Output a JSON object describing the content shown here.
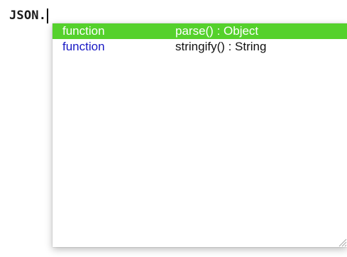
{
  "editor": {
    "code_text": "JSON."
  },
  "autocomplete": {
    "items": [
      {
        "kind": "function",
        "signature": "parse() : Object",
        "selected": true
      },
      {
        "kind": "function",
        "signature": "stringify() : String",
        "selected": false
      }
    ],
    "colors": {
      "selected_background": "#55d12c",
      "kind_text": "#1919c4",
      "selected_text": "#ffffff"
    },
    "icons": [
      "resize-grip-icon"
    ]
  }
}
